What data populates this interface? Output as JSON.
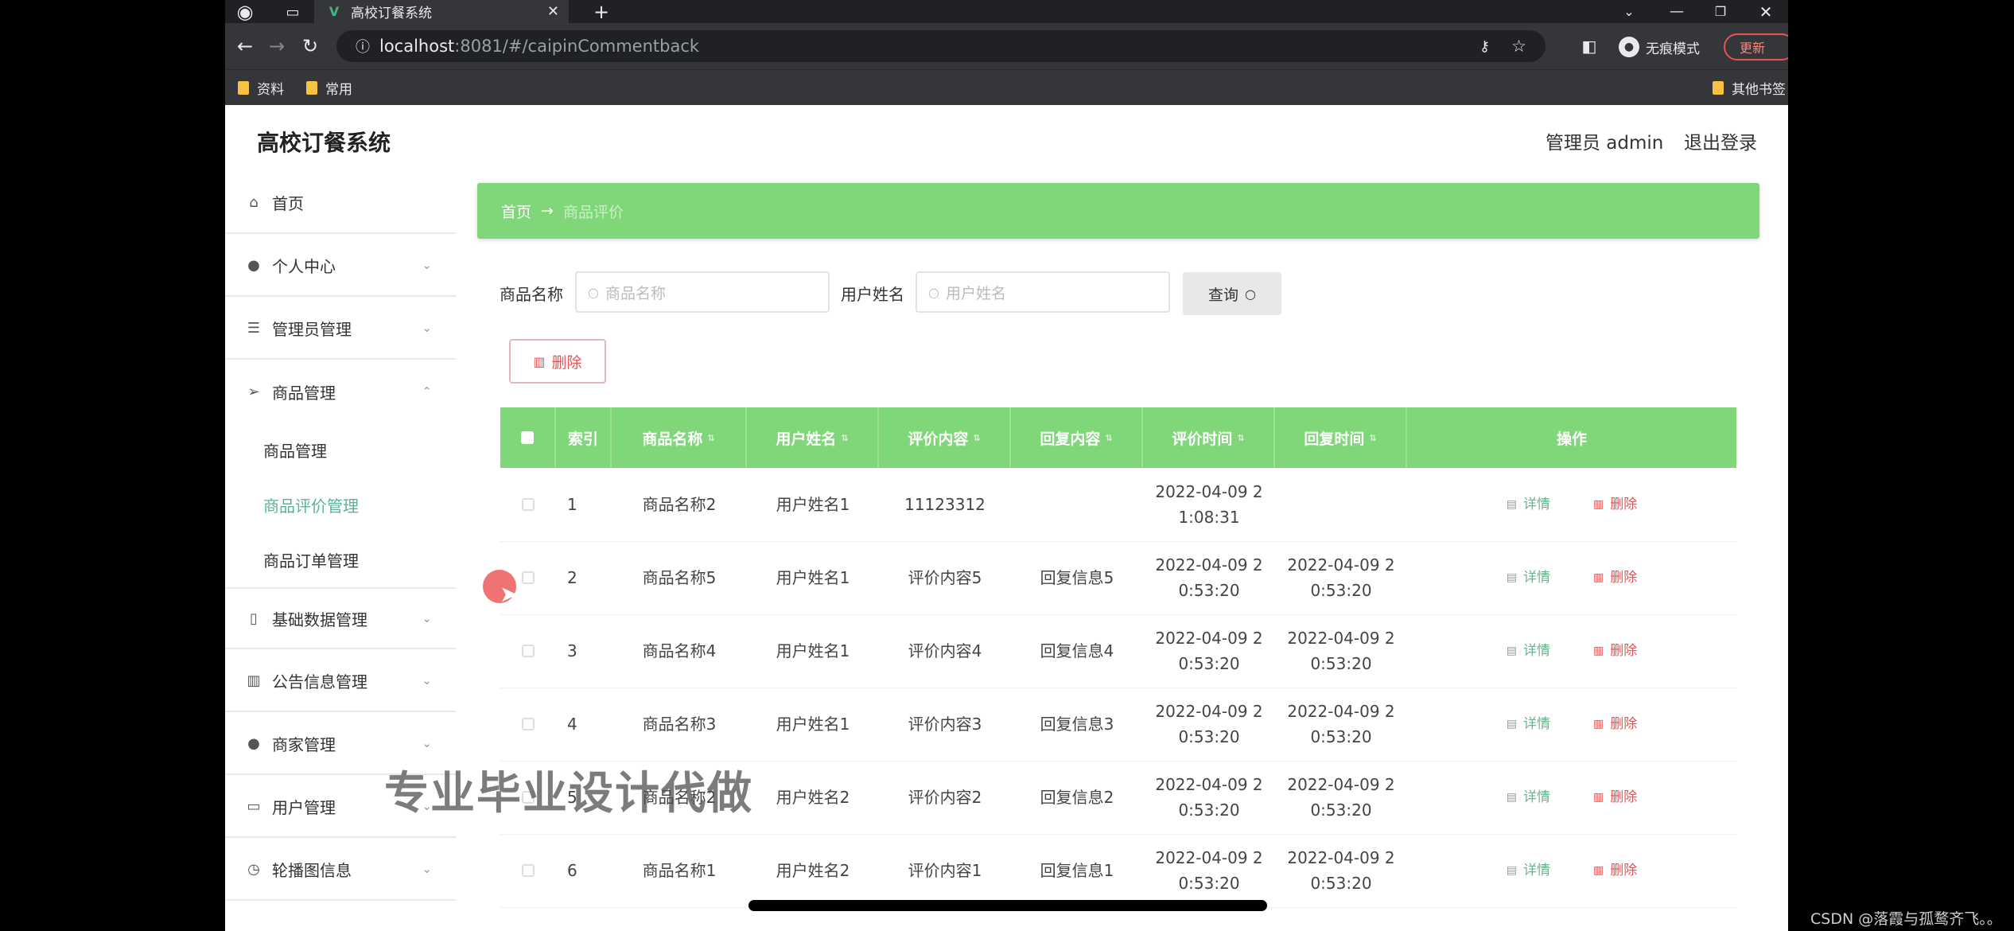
{
  "browser": {
    "tab_title": "高校订餐系统",
    "url_host": "localhost",
    "url_rest": ":8081/#/caipinCommentback",
    "incognito_label": "无痕模式",
    "update_label": "更新",
    "bookmarks": [
      "资料",
      "常用"
    ],
    "other_bookmarks": "其他书签"
  },
  "app": {
    "title": "高校订餐系统",
    "user_label": "管理员 admin",
    "logout_label": "退出登录"
  },
  "sidebar": {
    "items": [
      {
        "label": "首页",
        "icon": "home-icon"
      },
      {
        "label": "个人中心",
        "icon": "user-icon"
      },
      {
        "label": "管理员管理",
        "icon": "menu-icon"
      },
      {
        "label": "商品管理",
        "icon": "send-icon"
      },
      {
        "label": "基础数据管理",
        "icon": "phone-icon"
      },
      {
        "label": "公告信息管理",
        "icon": "chart-icon"
      },
      {
        "label": "商家管理",
        "icon": "pin-icon"
      },
      {
        "label": "用户管理",
        "icon": "card-icon"
      },
      {
        "label": "轮播图信息",
        "icon": "clock-icon"
      }
    ],
    "sub_items": [
      "商品管理",
      "商品评价管理",
      "商品订单管理"
    ]
  },
  "breadcrumb": {
    "home": "首页",
    "arrow": "→",
    "current": "商品评价"
  },
  "search": {
    "product_label": "商品名称",
    "product_placeholder": "商品名称",
    "user_label": "用户姓名",
    "user_placeholder": "用户姓名",
    "query_label": "查询",
    "delete_label": "删除"
  },
  "table": {
    "columns": [
      "索引",
      "商品名称",
      "用户姓名",
      "评价内容",
      "回复内容",
      "评价时间",
      "回复时间",
      "操作"
    ],
    "detail_label": "详情",
    "delete_label": "删除",
    "rows": [
      {
        "index": "1",
        "product": "商品名称2",
        "user": "用户姓名1",
        "content": "11123312",
        "reply": "",
        "eval_time_a": "2022-04-09 2",
        "eval_time_b": "1:08:31",
        "reply_time_a": "",
        "reply_time_b": ""
      },
      {
        "index": "2",
        "product": "商品名称5",
        "user": "用户姓名1",
        "content": "评价内容5",
        "reply": "回复信息5",
        "eval_time_a": "2022-04-09 2",
        "eval_time_b": "0:53:20",
        "reply_time_a": "2022-04-09 2",
        "reply_time_b": "0:53:20"
      },
      {
        "index": "3",
        "product": "商品名称4",
        "user": "用户姓名1",
        "content": "评价内容4",
        "reply": "回复信息4",
        "eval_time_a": "2022-04-09 2",
        "eval_time_b": "0:53:20",
        "reply_time_a": "2022-04-09 2",
        "reply_time_b": "0:53:20"
      },
      {
        "index": "4",
        "product": "商品名称3",
        "user": "用户姓名1",
        "content": "评价内容3",
        "reply": "回复信息3",
        "eval_time_a": "2022-04-09 2",
        "eval_time_b": "0:53:20",
        "reply_time_a": "2022-04-09 2",
        "reply_time_b": "0:53:20"
      },
      {
        "index": "5",
        "product": "商品名称2",
        "user": "用户姓名2",
        "content": "评价内容2",
        "reply": "回复信息2",
        "eval_time_a": "2022-04-09 2",
        "eval_time_b": "0:53:20",
        "reply_time_a": "2022-04-09 2",
        "reply_time_b": "0:53:20"
      },
      {
        "index": "6",
        "product": "商品名称1",
        "user": "用户姓名2",
        "content": "评价内容1",
        "reply": "回复信息1",
        "eval_time_a": "2022-04-09 2",
        "eval_time_b": "0:53:20",
        "reply_time_a": "2022-04-09 2",
        "reply_time_b": "0:53:20"
      }
    ]
  },
  "overlay_text": "专业毕业设计代做",
  "watermark": "CSDN @落霞与孤鹜齐飞。。",
  "colors": {
    "accent_green": "#7fd77a",
    "active_link": "#58b39b",
    "danger": "#e45656"
  }
}
